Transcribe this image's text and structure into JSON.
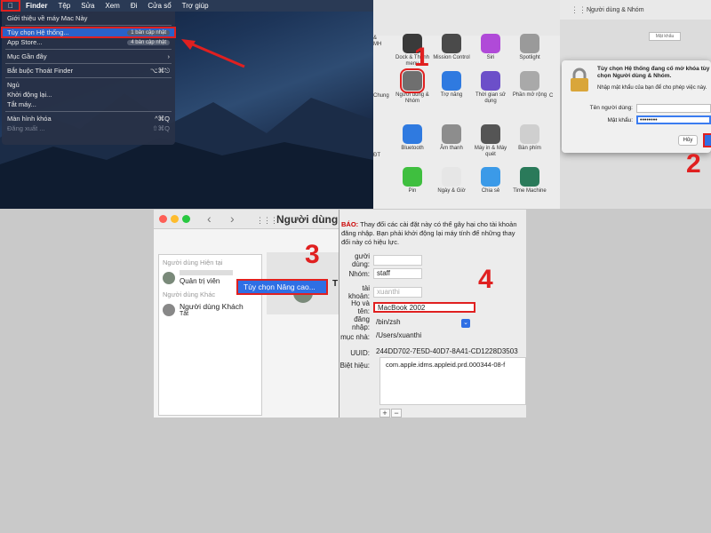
{
  "panel1": {
    "menubar": [
      "Finder",
      "Tệp",
      "Sửa",
      "Xem",
      "Đi",
      "Cửa sổ",
      "Trợ giúp"
    ],
    "menu": [
      {
        "label": "Giới thiệu về máy Mac Này",
        "badge": ""
      },
      {
        "label": "Tùy chọn Hệ thống...",
        "badge": "1 bản cập nhật",
        "selected": true
      },
      {
        "label": "App Store...",
        "badge": "4 bản cập nhật"
      },
      {
        "label": "Mục Gần đây",
        "badge": "›"
      },
      {
        "label": "Bắt buộc Thoát Finder",
        "badge": "⌥⌘⎋"
      },
      {
        "label": "Ngủ",
        "badge": ""
      },
      {
        "label": "Khởi động lại...",
        "badge": ""
      },
      {
        "label": "Tắt máy...",
        "badge": ""
      },
      {
        "label": "Màn hình khóa",
        "badge": "^⌘Q"
      },
      {
        "label": "Đăng xuất ...",
        "badge": "⇧⌘Q",
        "blurred": true
      }
    ]
  },
  "panel2": {
    "step": "1",
    "icons": [
      {
        "label": "Dock & Thanh menu",
        "color": "#3a3a3a"
      },
      {
        "label": "Mission Control",
        "color": "#4a4a4a"
      },
      {
        "label": "Siri",
        "color": "#b04ad8"
      },
      {
        "label": "Spotlight",
        "color": "#9a9a9a"
      },
      {
        "label": "Người dùng & Nhóm",
        "color": "#6f6f6f"
      },
      {
        "label": "Trợ năng",
        "color": "#2f7ae0"
      },
      {
        "label": "Thời gian sử dụng",
        "color": "#6c4fc9"
      },
      {
        "label": "Phần mở rộng",
        "color": "#a9a9a9"
      },
      {
        "label": "Bluetooth",
        "color": "#2f7ae0"
      },
      {
        "label": "Âm thanh",
        "color": "#8d8d8d"
      },
      {
        "label": "Máy in & Máy quét",
        "color": "#555555"
      },
      {
        "label": "Bàn phím",
        "color": "#cfcfcf"
      },
      {
        "label": "Pin",
        "color": "#3fbf3f"
      },
      {
        "label": "Ngày & Giờ",
        "color": "#e6e6e6"
      },
      {
        "label": "Chia sẻ",
        "color": "#3b9ae8"
      },
      {
        "label": "Time Machine",
        "color": "#2a7a5a"
      }
    ],
    "side_labels": [
      "& MH",
      "Chung",
      "ĐT",
      "C"
    ]
  },
  "panel3": {
    "step": "2",
    "window_title": "Người dùng & Nhóm",
    "auth_title": "Tùy chọn Hệ thống đang cố mở khóa tùy chọn Người dùng & Nhóm.",
    "auth_sub": "Nhập mật khẩu của bạn để cho phép việc này.",
    "user_label": "Tên người dùng:",
    "pass_label": "Mật khẩu:",
    "pass_value": "••••••••",
    "cancel": "Hủy",
    "top_button": "Mật khẩu"
  },
  "panel4": {
    "step": "3",
    "title": "Người dùng &",
    "current_users": "Người dùng Hiện tại",
    "admin": "Quản trị viên",
    "other_users": "Người dùng Khác",
    "guest": "Người dùng Khách",
    "guest_status": "Tắt",
    "context_item": "Tùy chọn Nâng cao...",
    "right_initial": "T"
  },
  "panel5": {
    "step": "4",
    "warn_label": "BÁO:",
    "warn_text": "Thay đổi các cài đặt này có thể gây hại cho tài khoản đăng nhập. Bạn phải khởi động lại máy tính để những thay đổi này có hiệu lực.",
    "fields": [
      {
        "label": "gười dùng:",
        "value": ""
      },
      {
        "label": "Nhóm:",
        "value": "staff"
      },
      {
        "label": "tài khoản:",
        "value": "xuanthi",
        "muted": true
      },
      {
        "label": "Họ và tên:",
        "value": "MacBook 2002",
        "highlight": true
      },
      {
        "label": "đăng nhập:",
        "value": "/bin/zsh",
        "select": true
      },
      {
        "label": "mục nhà:",
        "value": "/Users/xuanthi"
      },
      {
        "label": "UUID:",
        "value": "244DD702-7E5D-40D7-8A41-CD1228D3503"
      },
      {
        "label": "Biệt hiệu:",
        "value": ""
      }
    ],
    "alias": "com.apple.idms.appleid.prd.000344-08-f",
    "plus": "+",
    "minus": "−"
  }
}
